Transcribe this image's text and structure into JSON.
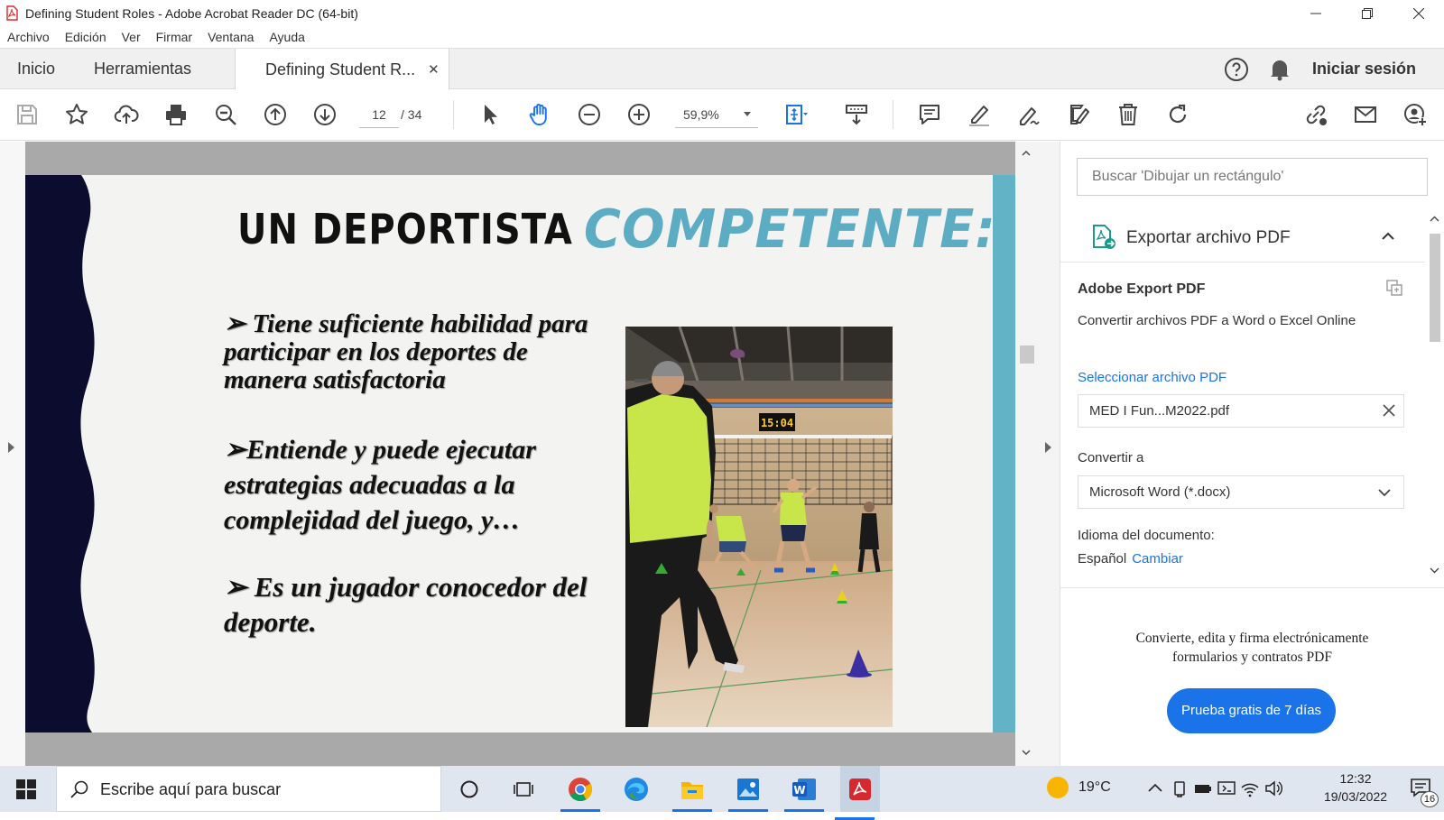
{
  "window": {
    "title": "Defining Student Roles - Adobe Acrobat Reader DC (64-bit)"
  },
  "menu": [
    "Archivo",
    "Edición",
    "Ver",
    "Firmar",
    "Ventana",
    "Ayuda"
  ],
  "tabs": {
    "home": "Inicio",
    "tools": "Herramientas",
    "document": "Defining Student R...",
    "sign_in": "Iniciar sesión"
  },
  "toolbar": {
    "page_current": "12",
    "page_total": "/ 34",
    "zoom": "59,9%"
  },
  "slide": {
    "title_part1": "UN DEPORTISTA",
    "title_part2": "COMPETENTE:",
    "bullets": [
      "➢ Tiene suficiente habilidad para participar en los deportes de manera satisfactoria",
      "➢Entiende y puede ejecutar estrategias adecuadas a la complejidad del juego, y…",
      "➢ Es un jugador conocedor del deporte."
    ],
    "scoreboard": "15:04"
  },
  "panel": {
    "search_placeholder": "Buscar 'Dibujar un rectángulo'",
    "export_title": "Exportar archivo PDF",
    "service_name": "Adobe Export PDF",
    "service_desc": "Convertir archivos PDF a Word o Excel Online",
    "select_link": "Seleccionar archivo PDF",
    "file_name": "MED I Fun...M2022.pdf",
    "convert_label": "Convertir a",
    "convert_value": "Microsoft Word (*.docx)",
    "lang_label": "Idioma del documento:",
    "lang_value": "Español",
    "lang_change": "Cambiar",
    "promo_line1": "Convierte, edita y firma electrónicamente",
    "promo_line2": "formularios y contratos PDF",
    "trial_button": "Prueba gratis de 7 días"
  },
  "taskbar": {
    "search_placeholder": "Escribe aquí para buscar",
    "temperature": "19°C",
    "time": "12:32",
    "date": "19/03/2022",
    "notifications": "16"
  }
}
